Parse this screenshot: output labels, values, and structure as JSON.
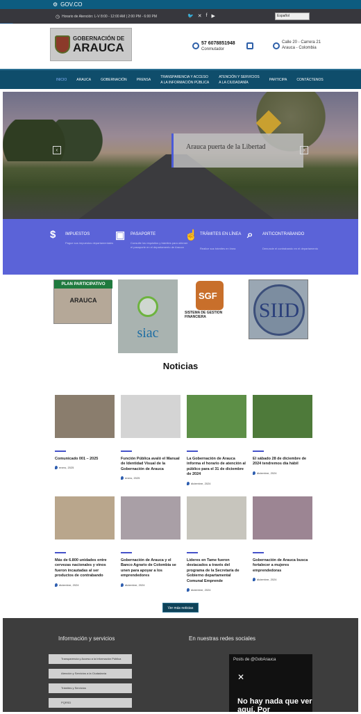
{
  "topbar": {
    "label": "GOV.CO"
  },
  "infobar": {
    "hours": "Horario de Atención: L-V 8:00 - 12:00 AM | 2:00 PM - 6:00 PM",
    "lang": "Español"
  },
  "header": {
    "logo_line1": "GOBERNACIÓN DE",
    "logo_line2": "ARAUCA",
    "phone": "57 6078851948",
    "phone_sub": "Conmutador",
    "address1": "Calle 20 - Carrera 21",
    "address2": "Arauca - Colombia"
  },
  "nav": {
    "items": [
      {
        "label": "INICIO",
        "sub": ""
      },
      {
        "label": "ARAUCA",
        "sub": ""
      },
      {
        "label": "GOBERNACIÓN",
        "sub": ""
      },
      {
        "label": "PRENSA",
        "sub": ""
      },
      {
        "label": "TRANSPARENCIA Y ACCESO",
        "sub": "A LA INFORMACIÓN PÚBLICA"
      },
      {
        "label": "ATENCIÓN Y SERVICIOS",
        "sub": "A LA CIUDADANÍA"
      },
      {
        "label": "PARTICIPA",
        "sub": ""
      },
      {
        "label": "CONTÁCTENOS",
        "sub": ""
      }
    ]
  },
  "hero": {
    "caption": "Arauca puerta de la Libertad",
    "prev": "‹",
    "next": "›"
  },
  "services": [
    {
      "icon": "$",
      "title": "IMPUESTOS",
      "desc": "Pague sus impuestos departamentales"
    },
    {
      "icon": "▣",
      "title": "PASAPORTE",
      "desc": "Consulte los requisitos y trámites para obtener el pasaporte en el departamento de Arauca"
    },
    {
      "icon": "☝",
      "title": "TRÁMITES EN LÍNEA",
      "desc": "Realice sus trámites en línea"
    },
    {
      "icon": "⌕",
      "title": "ANTICONTRABANDO",
      "desc": "Denuncie el contrabando en el departamento"
    }
  ],
  "partners": {
    "p1_head": "PLAN PARTICIPATIVO",
    "p1_main": "ARAUCA",
    "p2": "siac",
    "p3_logo": "SGF",
    "p3_text": "SISTEMA DE GESTION FINANCIERA",
    "p4": "SIID"
  },
  "news": {
    "title": "Noticias",
    "more": "Ver más noticias",
    "items": [
      {
        "headline": "Comunicado 001 – 2025",
        "date": "enero, 2025",
        "color": "#8a7d6d"
      },
      {
        "headline": "Función Pública avaló el Manual de Identidad Visual de la Gobernación de Arauca",
        "date": "enero, 2025",
        "color": "#c9c9c9"
      },
      {
        "headline": "La Gobernación de Arauca informa el horario de atención al público para el 31 de diciembre de 2024",
        "date": "diciembre, 2024",
        "color": "#5d8f47"
      },
      {
        "headline": "El sábado 28 de diciembre de 2024 tendremos día hábil",
        "date": "diciembre, 2024",
        "color": "#4e7a3a"
      },
      {
        "headline": "Más de 6.800 unidades entre cervezas nacionales y vinos fueron incautadas al ser productos de contrabando",
        "date": "diciembre, 2024",
        "color": "#b9a68c"
      },
      {
        "headline": "Gobernación de Arauca y el Banco Agrario de Colombia se unen para apoyar a los emprendedores",
        "date": "diciembre, 2024",
        "color": "#a99fa6"
      },
      {
        "headline": "Líderes en Tame fueron destacados a través del programa de la Secretaría de Gobierno departamental Comunal Emprende",
        "date": "diciembre, 2024",
        "color": "#c7c5bd"
      },
      {
        "headline": "Gobernación de Arauca busca fortalecer a mujeres emprendedoras",
        "date": "diciembre, 2024",
        "color": "#9c8593"
      }
    ]
  },
  "footer": {
    "services_title": "Información y servicios",
    "social_title": "En nuestras redes sociales",
    "links": [
      "Transparencia y Acceso a la Información Pública",
      "Atención y Servicios a la Ciudadanía",
      "Trámites y Servicios",
      "PQRSD"
    ],
    "tw_header": "Posts de @GobArauca",
    "tw_msg": "No hay nada que ver aquí. Por"
  }
}
